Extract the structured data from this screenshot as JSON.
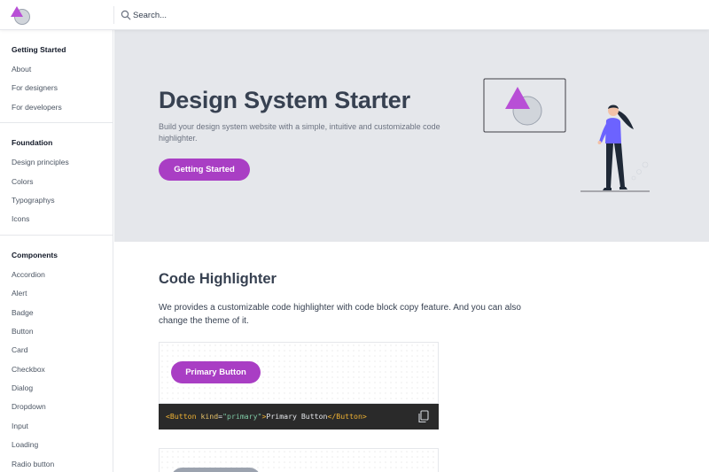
{
  "header": {
    "logo_icon": "triangle-circle-logo",
    "search_placeholder": "Search..."
  },
  "sidebar": {
    "groups": [
      {
        "heading": "Getting Started",
        "items": [
          "About",
          "For designers",
          "For developers"
        ]
      },
      {
        "heading": "Foundation",
        "items": [
          "Design principles",
          "Colors",
          "Typographys",
          "Icons"
        ]
      },
      {
        "heading": "Components",
        "items": [
          "Accordion",
          "Alert",
          "Badge",
          "Button",
          "Card",
          "Checkbox",
          "Dialog",
          "Dropdown",
          "Input",
          "Loading",
          "Radio button"
        ]
      }
    ]
  },
  "hero": {
    "title": "Design System Starter",
    "description": "Build your design system website with a simple, intuitive and customizable code highlighter.",
    "cta_label": "Getting Started"
  },
  "main": {
    "section_title": "Code Highlighter",
    "section_description": "We provides a customizable code highlighter with code block copy feature. And you can also change the theme of it.",
    "example": {
      "button_label": "Primary Button",
      "code": {
        "open_tag_start": "<Button",
        "attr_name": "kind",
        "attr_eq": "=",
        "attr_value": "\"primary\"",
        "open_tag_end": ">",
        "text": "Primary Button",
        "close_tag": "</Button",
        "close_tag_end": ">"
      },
      "copy_icon": "copy-icon"
    }
  },
  "colors": {
    "accent": "#a93ec4",
    "hero_bg": "#e5e7eb",
    "code_bg": "#2a2a2a",
    "illustration_person_top": "#6c63ff"
  }
}
